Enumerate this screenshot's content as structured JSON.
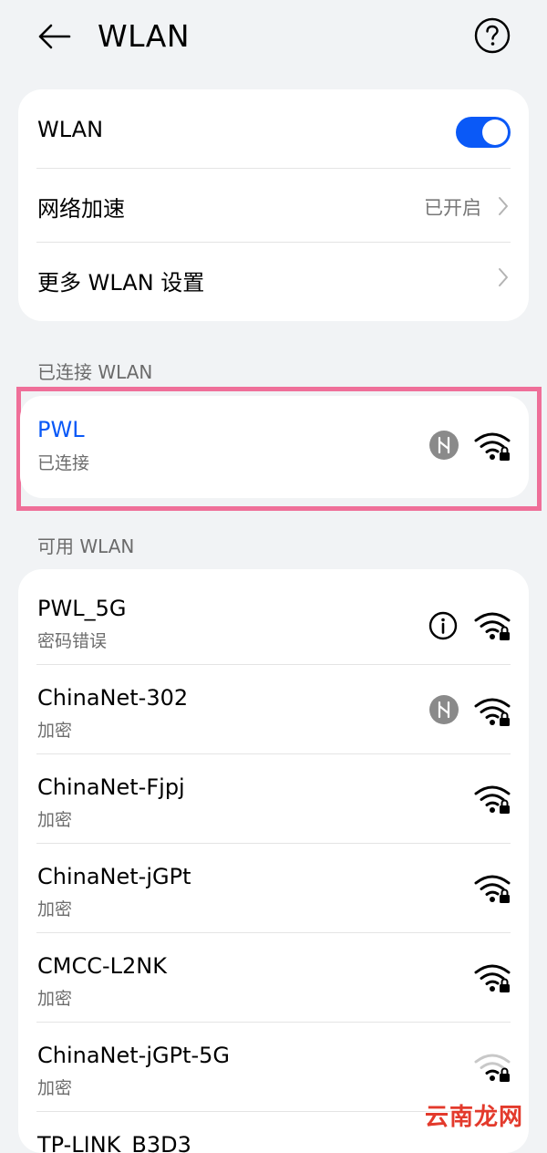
{
  "header": {
    "title": "WLAN"
  },
  "settings": {
    "wlan_label": "WLAN",
    "wlan_on": true,
    "accel_label": "网络加速",
    "accel_value": "已开启",
    "more_label": "更多 WLAN 设置"
  },
  "connected_section": {
    "title": "已连接 WLAN",
    "network": {
      "ssid": "PWL",
      "status": "已连接"
    }
  },
  "available_section": {
    "title": "可用 WLAN",
    "networks": [
      {
        "ssid": "PWL_5G",
        "status": "密码错误"
      },
      {
        "ssid": "ChinaNet-302",
        "status": "加密"
      },
      {
        "ssid": "ChinaNet-Fjpj",
        "status": "加密"
      },
      {
        "ssid": "ChinaNet-jGPt",
        "status": "加密"
      },
      {
        "ssid": "CMCC-L2NK",
        "status": "加密"
      },
      {
        "ssid": "ChinaNet-jGPt-5G",
        "status": "加密"
      },
      {
        "ssid": "TP-LINK_B3D3",
        "status": ""
      }
    ]
  },
  "icons": {
    "accent": "#0a59f7",
    "highlight": "#ef6f99"
  },
  "watermark": "云南龙网"
}
